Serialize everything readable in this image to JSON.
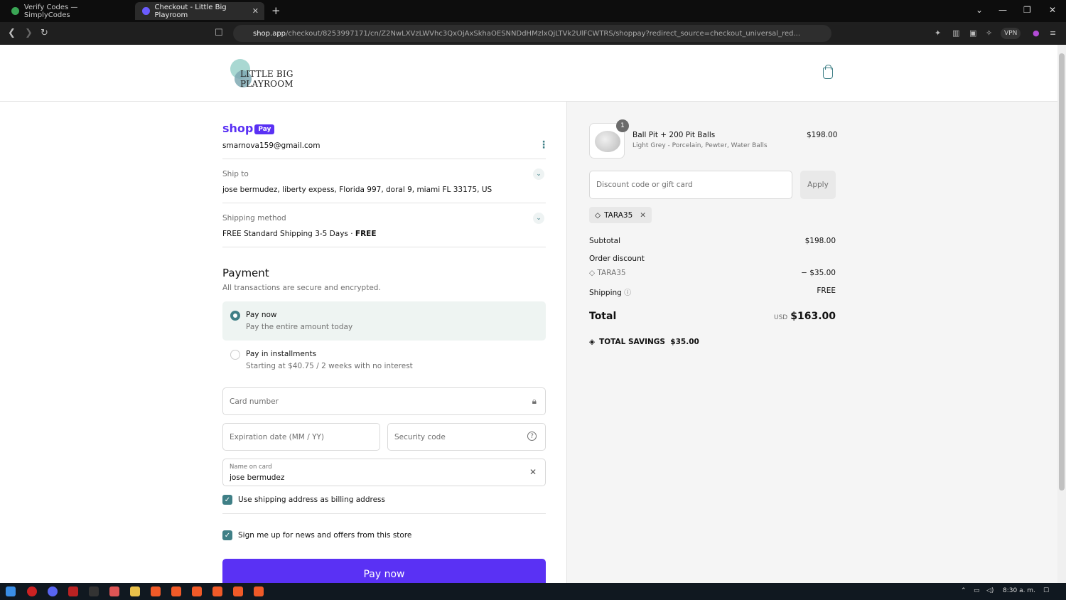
{
  "browser": {
    "tabs": [
      {
        "title": "Verify Codes — SimplyCodes"
      },
      {
        "title": "Checkout - Little Big Playroom"
      }
    ],
    "url_host": "shop.app",
    "url_path": "/checkout/8253997171/cn/Z2NwLXVzLWVhc3QxOjAxSkhaOESNNDdHMzlxQjLTVk2UlFCWTRS/shoppay?redirect_source=checkout_universal_red...",
    "vpn_label": "VPN"
  },
  "store": {
    "logo_text": "LITTLE BIG PLAYROOM"
  },
  "shop_pay": {
    "brand": "shop",
    "badge": "Pay",
    "email": "smarnova159@gmail.com"
  },
  "ship_to": {
    "label": "Ship to",
    "value": "jose bermudez, liberty expess, Florida 997, doral 9, miami FL 33175, US"
  },
  "shipping_method": {
    "label": "Shipping method",
    "value": "FREE Standard Shipping 3-5 Days · ",
    "price": "FREE"
  },
  "payment": {
    "title": "Payment",
    "subtitle": "All transactions are secure and encrypted.",
    "options": [
      {
        "title": "Pay now",
        "desc": "Pay the entire amount today",
        "selected": true
      },
      {
        "title": "Pay in installments",
        "desc": "Starting at $40.75 / 2 weeks with no interest",
        "selected": false
      }
    ],
    "card_number_placeholder": "Card number",
    "expiration_placeholder": "Expiration date (MM / YY)",
    "security_placeholder": "Security code",
    "name_label": "Name on card",
    "name_value": "jose bermudez",
    "billing_checkbox": "Use shipping address as billing address",
    "news_checkbox": "Sign me up for news and offers from this store",
    "pay_button": "Pay now"
  },
  "summary": {
    "item": {
      "qty": "1",
      "name": "Ball Pit + 200 Pit Balls",
      "variant": "Light Grey - Porcelain, Pewter, Water Balls",
      "price": "$198.00"
    },
    "discount_placeholder": "Discount code or gift card",
    "apply_label": "Apply",
    "applied_code": "TARA35",
    "subtotal_label": "Subtotal",
    "subtotal_value": "$198.00",
    "order_discount_label": "Order discount",
    "discount_code": "TARA35",
    "discount_value": "− $35.00",
    "shipping_label": "Shipping",
    "shipping_value": "FREE",
    "total_label": "Total",
    "currency": "USD",
    "total_value": "$163.00",
    "savings_label": "TOTAL SAVINGS",
    "savings_value": "$35.00"
  },
  "taskbar": {
    "time": "8:30 a. m."
  },
  "colors": {
    "accent": "#5a31f4",
    "teal": "#3f7f86"
  }
}
